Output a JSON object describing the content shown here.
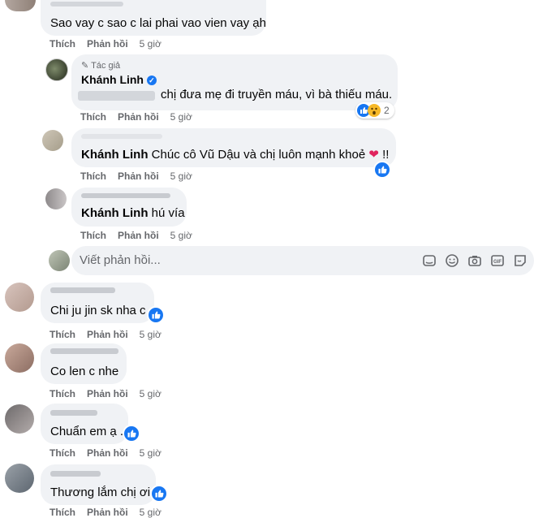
{
  "comments": [
    {
      "text": "Sao vay c sao c lai phai vao vien vay ạh",
      "like": "Thích",
      "reply": "Phản hồi",
      "time": "5 giờ"
    },
    {
      "badge": "Tác giả",
      "name": "Khánh Linh",
      "text": "chị đưa mẹ đi truyền máu, vì bà thiếu máu.",
      "reaction_count": "2",
      "like": "Thích",
      "reply": "Phản hồi",
      "time": "5 giờ"
    },
    {
      "mention": "Khánh Linh",
      "text": "Chúc cô Vũ Dậu và chị luôn mạnh khoẻ",
      "suffix": "!!",
      "like": "Thích",
      "reply": "Phản hồi",
      "time": "5 giờ"
    },
    {
      "mention": "Khánh Linh",
      "text": "hú vía",
      "like": "Thích",
      "reply": "Phản hồi",
      "time": "5 giờ"
    },
    {
      "text": "Chi ju jin sk nha c",
      "like": "Thích",
      "reply": "Phản hồi",
      "time": "5 giờ"
    },
    {
      "text": "Co len c nhe",
      "like": "Thích",
      "reply": "Phản hồi",
      "time": "5 giờ"
    },
    {
      "text": "Chuẩn em ạ .",
      "like": "Thích",
      "reply": "Phản hồi",
      "time": "5 giờ"
    },
    {
      "text": "Thương lắm chị ơi",
      "like": "Thích",
      "reply": "Phản hồi",
      "time": "5 giờ"
    }
  ],
  "reply_box": {
    "placeholder": "Viết phản hồi..."
  },
  "reply_icons": [
    "sticker-icon",
    "emoji-icon",
    "camera-icon",
    "gif-icon",
    "avatar-sticker-icon"
  ],
  "colors": {
    "bubble": "#f0f2f5",
    "meta": "#65676b",
    "like_blue": "#1877f2",
    "heart": "#e0245e"
  }
}
